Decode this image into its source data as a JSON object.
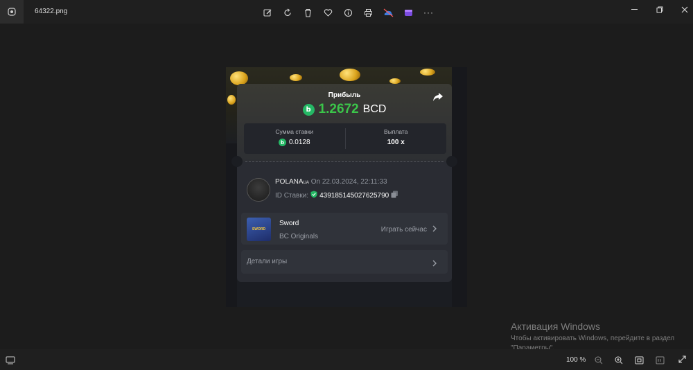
{
  "window": {
    "filename": "64322.png"
  },
  "toolbar": {
    "icons": [
      "edit-icon",
      "rotate-icon",
      "delete-icon",
      "favorite-icon",
      "info-icon",
      "print-icon",
      "onedrive-icon",
      "clipchamp-icon",
      "more-icon"
    ],
    "more_label": "···"
  },
  "bet_card": {
    "profit_label": "Прибыль",
    "profit_value": "1.2672",
    "currency": "BCD",
    "coin_symbol": "b",
    "bet_amount_label": "Сумма ставки",
    "bet_amount_value": "0.0128",
    "payout_label": "Выплата",
    "payout_value": "100 x",
    "user": {
      "name": "POLANA",
      "name_tag": "UA",
      "on_label": "On",
      "date": "22.03.2024, 22:11:33",
      "id_label": "ID Ставки:",
      "id_value": "439185145027625790"
    },
    "game": {
      "name": "Sword",
      "category": "BC Originals",
      "play_label": "Играть сейчас",
      "thumb_text": "SWORD"
    },
    "details_label": "Детали игры"
  },
  "activation": {
    "title": "Активация Windows",
    "subtitle": "Чтобы активировать Windows, перейдите в раздел \"Параметры\"."
  },
  "status": {
    "zoom": "100 %"
  },
  "colors": {
    "profit_green": "#3bc54a",
    "coin_green": "#25b865",
    "card_bg": "#2a2c33",
    "viewer_bg": "#1c1c1c"
  }
}
